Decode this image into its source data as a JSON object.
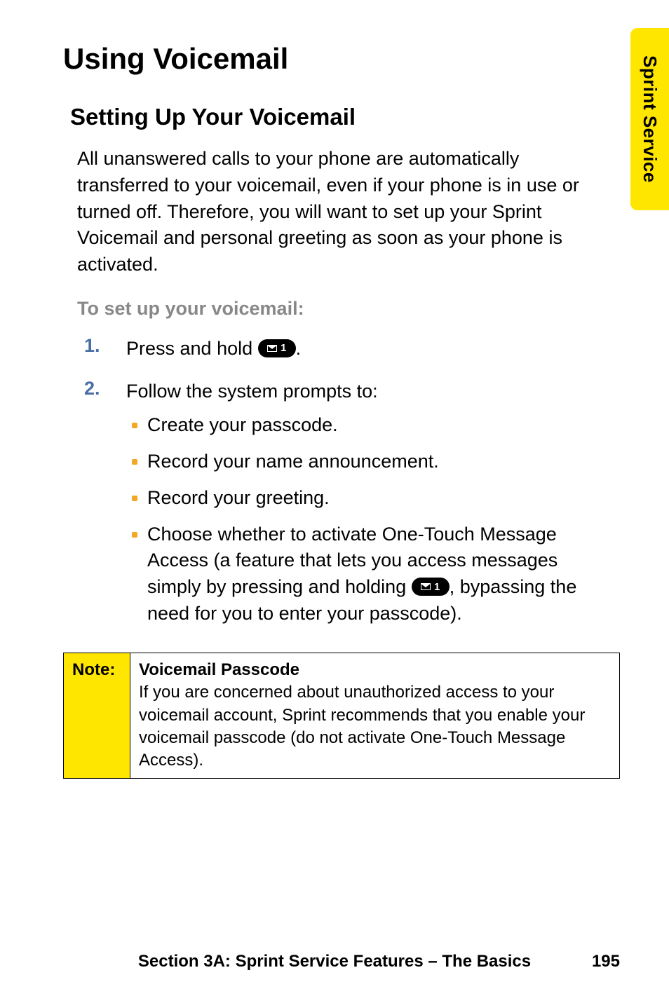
{
  "side_tab": "Sprint Service",
  "h1": "Using Voicemail",
  "h2": "Setting Up Your Voicemail",
  "intro": "All unanswered calls to your phone are automatically transferred to your voicemail, even if your phone is in use or turned off. Therefore, you will want to set up your Sprint Voicemail and personal greeting as soon as your phone is activated.",
  "subhead": "To set up your voicemail:",
  "steps": {
    "s1": {
      "num": "1.",
      "pre": "Press and hold ",
      "key": "1",
      "post": "."
    },
    "s2": {
      "num": "2.",
      "lead": "Follow the system prompts to:",
      "bullets": {
        "b0": "Create your passcode.",
        "b1": "Record your name announcement.",
        "b2": "Record your greeting.",
        "b3_pre": "Choose whether to activate One-Touch Message Access (a feature that lets you access messages simply by pressing and holding ",
        "b3_key": "1",
        "b3_post": ", bypassing the need for you to enter your passcode)."
      }
    }
  },
  "note": {
    "label": "Note:",
    "title": "Voicemail Passcode",
    "body": "If you are concerned about unauthorized access to your voicemail account, Sprint recommends that you enable your voicemail passcode (do not activate One-Touch Message Access)."
  },
  "footer": {
    "section": "Section 3A: Sprint Service Features – The Basics",
    "page": "195"
  }
}
